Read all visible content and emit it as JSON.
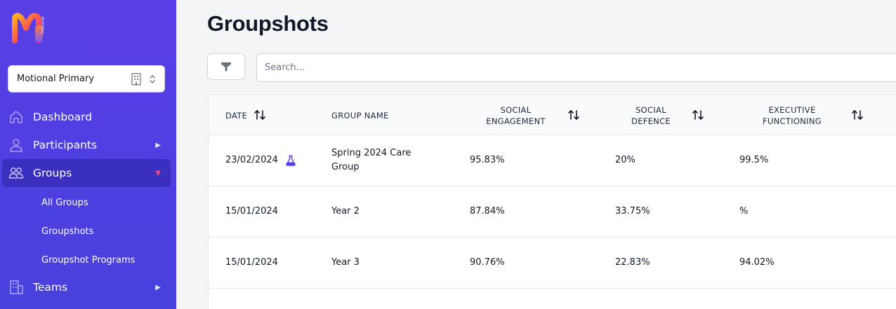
{
  "brand": {
    "logo_text": "motional"
  },
  "org_select": {
    "label": "Motional Primary"
  },
  "nav": {
    "dashboard": "Dashboard",
    "participants": "Participants",
    "groups": "Groups",
    "teams": "Teams",
    "sub": {
      "all_groups": "All Groups",
      "groupshots": "Groupshots",
      "groupshot_programs": "Groupshot Programs"
    }
  },
  "page": {
    "title": "Groupshots"
  },
  "search": {
    "placeholder": "Search..."
  },
  "table": {
    "headers": {
      "date": "DATE",
      "group_name": "GROUP NAME",
      "social_engagement": "SOCIAL ENGAGEMENT",
      "social_defence": "SOCIAL DEFENCE",
      "executive_functioning": "EXECUTIVE FUNCTIONING"
    },
    "rows": [
      {
        "date": "23/02/2024",
        "group": "Spring 2024 Care Group",
        "engagement": "95.83%",
        "defence": "20%",
        "exec": "99.5%",
        "flask": true
      },
      {
        "date": "15/01/2024",
        "group": "Year 2",
        "engagement": "87.84%",
        "defence": "33.75%",
        "exec": "%"
      },
      {
        "date": "15/01/2024",
        "group": "Year 3",
        "engagement": "90.76%",
        "defence": "22.83%",
        "exec": "94.02%"
      }
    ]
  },
  "colors": {
    "sidebar": "#5a3fe6",
    "active_nav": "#3b2fbf",
    "accent": "#ef4b7e",
    "flask": "#5b3fe6"
  }
}
